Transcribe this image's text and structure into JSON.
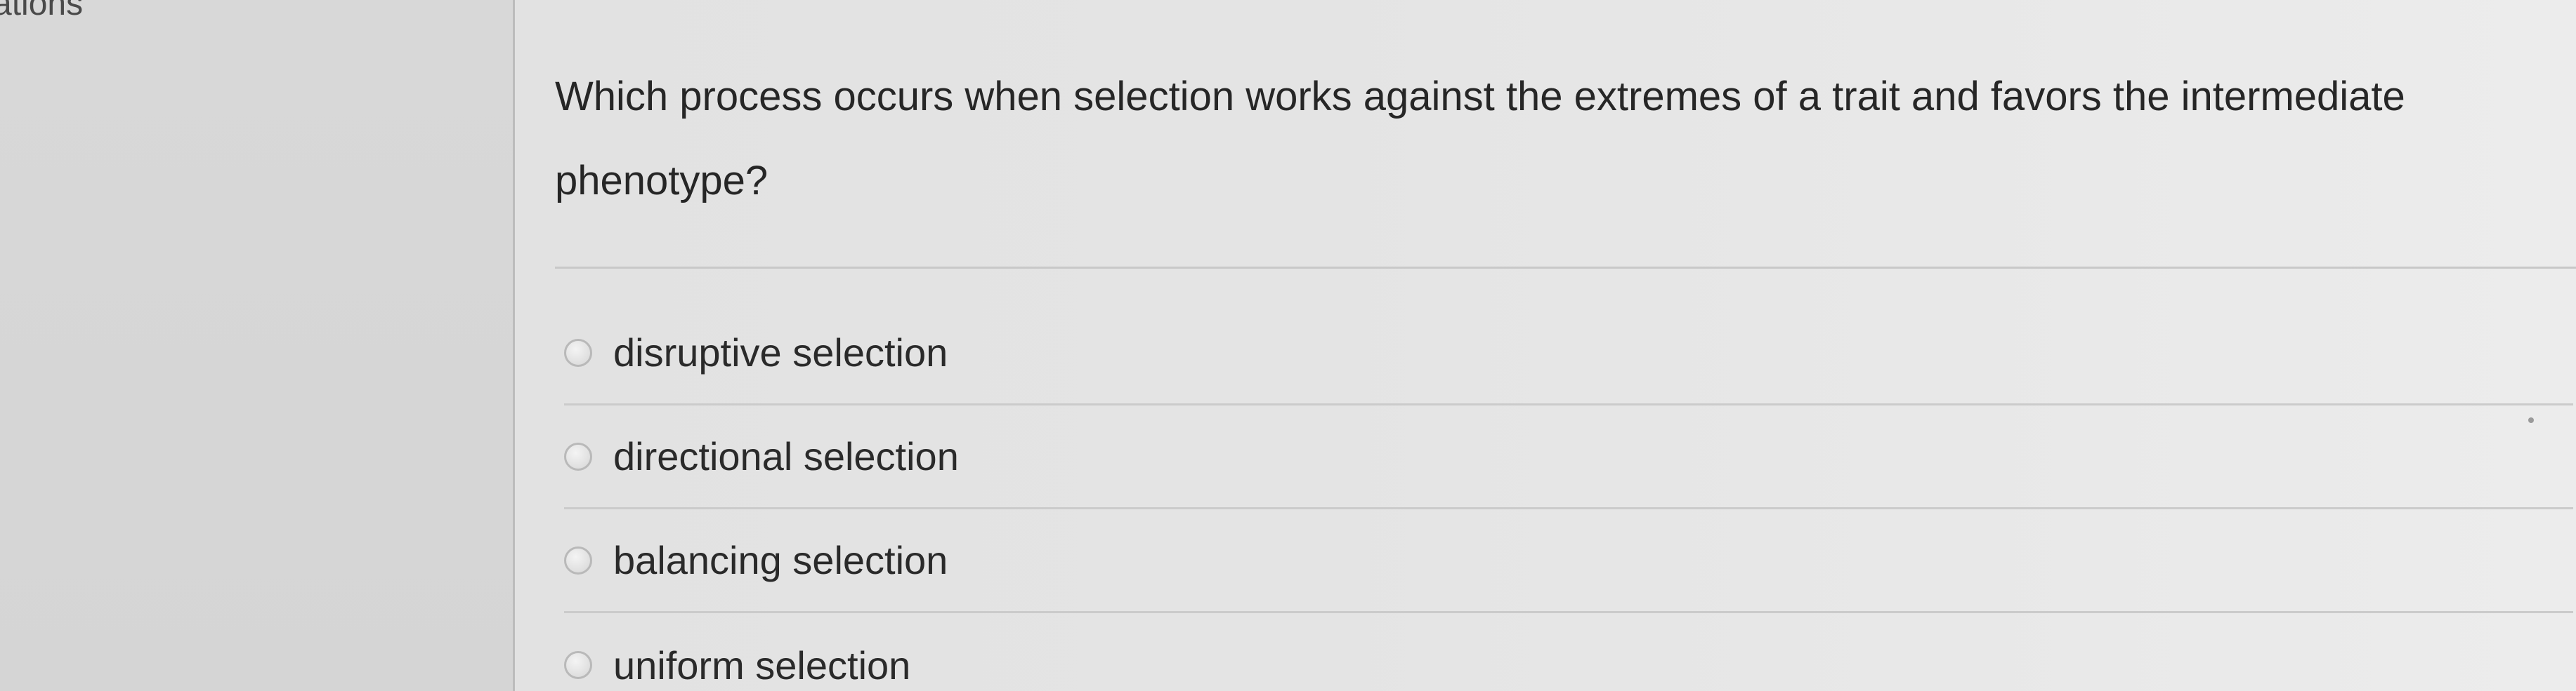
{
  "left_nav": {
    "partial_label": "ations"
  },
  "question": {
    "text": "Which process occurs when selection works against the extremes of a trait and favors the intermediate phenotype?"
  },
  "options": [
    {
      "label": "disruptive selection",
      "selected": false
    },
    {
      "label": "directional selection",
      "selected": false
    },
    {
      "label": "balancing selection",
      "selected": false
    },
    {
      "label": "uniform selection",
      "selected": false
    }
  ]
}
